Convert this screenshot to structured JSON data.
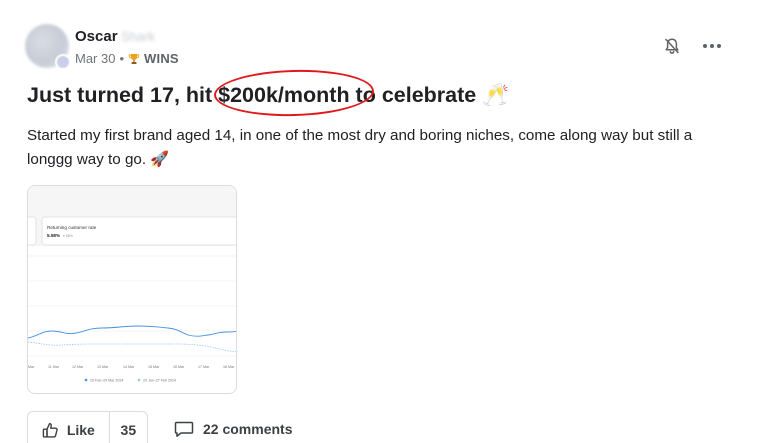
{
  "post": {
    "author": {
      "name": "Oscar",
      "level_label": "Shark"
    },
    "date": "Mar 30",
    "separator": "•",
    "category": "WINS",
    "title": {
      "before": "Just turned 17, hit ",
      "highlight": "$200k/month",
      "after": " to celebrate ",
      "emoji": "🥂"
    },
    "body": "Started my first brand aged 14, in one of the most dry and boring niches, come along way but still a longgg way to go. 🚀",
    "icons": {
      "bell": "bell-icon",
      "more": "more-icon",
      "trophy": "trophy-icon",
      "like": "thumbs-up-icon",
      "comment": "comment-icon"
    },
    "actions": {
      "like_label": "Like",
      "like_count": "35",
      "comments_label": "22 comments"
    },
    "highlight_color": "#e0191d"
  },
  "attachment": {
    "card_title": "Returning customer rate",
    "card_value": "5.58%",
    "card_delta": "▾ 58%",
    "x_ticks": [
      "Mar",
      "11 Mar",
      "12 Mar",
      "13 Mar",
      "14 Mar",
      "15 Mar",
      "16 Mar",
      "17 Mar",
      "18 Mar"
    ],
    "legend": [
      "29 Feb–29 Mar 2024",
      "29 Jan–27 Feb 2024"
    ],
    "series_colors": [
      "#4a90e2",
      "#9cc3ef"
    ]
  }
}
